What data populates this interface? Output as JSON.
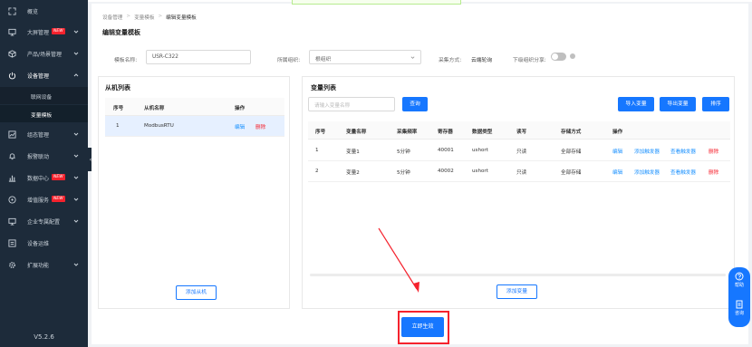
{
  "sidebar": {
    "items": [
      {
        "label": "概览",
        "icon": "overview-icon"
      },
      {
        "label": "大屏管理",
        "icon": "monitor-icon",
        "badge": "NEW"
      },
      {
        "label": "产品/场景管理",
        "icon": "cube-icon"
      },
      {
        "label": "设备管理",
        "icon": "power-icon"
      },
      {
        "label": "组态管理",
        "icon": "chart-icon"
      },
      {
        "label": "报警联动",
        "icon": "bell-icon"
      },
      {
        "label": "数据中心",
        "icon": "bar-chart-icon",
        "badge": "NEW"
      },
      {
        "label": "增值服务",
        "icon": "compass-icon",
        "badge": "NEW"
      },
      {
        "label": "企业专属配置",
        "icon": "screen-icon"
      },
      {
        "label": "设备运维",
        "icon": "tool-icon"
      },
      {
        "label": "扩展功能",
        "icon": "gear-icon"
      }
    ],
    "sub_items": [
      "联网设备",
      "变量模板"
    ],
    "version": "V5.2.6"
  },
  "breadcrumb": [
    "设备管理",
    "变量模板",
    "编辑变量模板"
  ],
  "page_title": "编辑变量模板",
  "form": {
    "template_name_label": "模板名称:",
    "template_name_value": "USR-C322",
    "org_label": "所属组织:",
    "org_placeholder": "根组织",
    "collect_label": "采集方式:",
    "collect_value": "云端轮询",
    "share_label": "下级组织分享:"
  },
  "slave_panel": {
    "title": "从机列表",
    "headers": [
      "序号",
      "从机名称",
      "操作"
    ],
    "rows": [
      {
        "no": "1",
        "name": "ModbusRTU",
        "edit": "编辑",
        "delete": "删除"
      }
    ],
    "add_button": "添加从机"
  },
  "var_panel": {
    "title": "变量列表",
    "search_placeholder": "请输入变量名称",
    "search_button": "查询",
    "import_button": "导入变量",
    "export_button": "导出变量",
    "sort_button": "排序",
    "headers": [
      "序号",
      "变量名称",
      "采集频率",
      "寄存器",
      "数据类型",
      "读写",
      "存储方式",
      "操作"
    ],
    "rows": [
      {
        "no": "1",
        "name": "变量1",
        "freq": "5分钟",
        "reg": "40001",
        "type": "ushort",
        "rw": "只读",
        "store": "全部存储"
      },
      {
        "no": "2",
        "name": "变量2",
        "freq": "5分钟",
        "reg": "40002",
        "type": "ushort",
        "rw": "只读",
        "store": "全部存储"
      }
    ],
    "row_actions": {
      "edit": "编辑",
      "add_trigger": "添加触发器",
      "view_trigger": "查看触发器",
      "delete": "删除"
    },
    "add_button": "添加变量"
  },
  "submit_button": "立即生效",
  "float": {
    "help": "帮助",
    "consult": "咨询"
  },
  "colors": {
    "primary": "#1677ff",
    "danger": "#f5222d",
    "sidebar_bg": "#1d2b3a"
  }
}
